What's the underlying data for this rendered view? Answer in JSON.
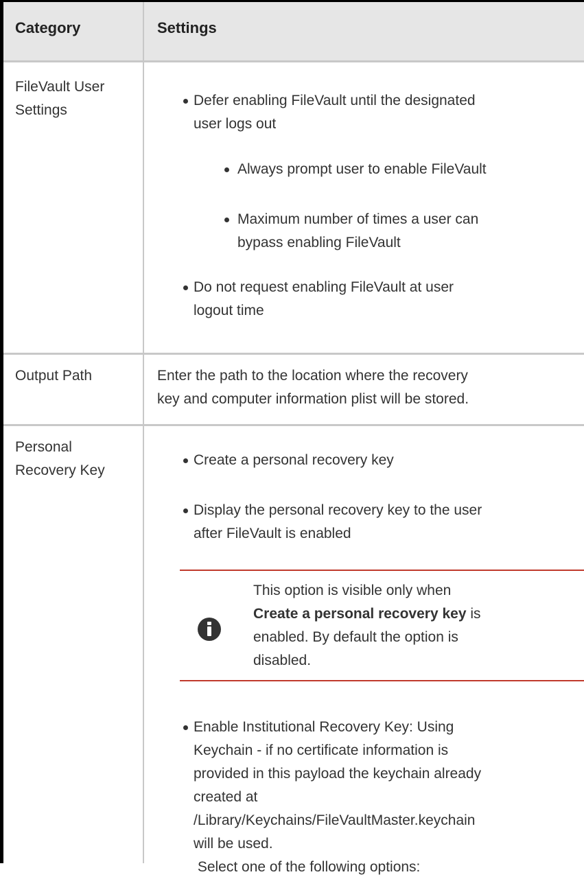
{
  "table": {
    "headers": {
      "category": "Category",
      "settings": "Settings"
    },
    "rows": [
      {
        "category": [
          "FileVault User",
          "Settings"
        ],
        "items": [
          [
            "Defer enabling FileVault until the designated",
            "user logs out"
          ],
          [
            "Always prompt user to enable FileVault"
          ],
          [
            "Maximum number of times a user can",
            "bypass enabling FileVault"
          ],
          [
            "Do not request enabling FileVault at user",
            "logout time"
          ]
        ]
      },
      {
        "category": [
          "Output Path"
        ],
        "text": [
          "Enter the path to the location where the recovery",
          "key and computer information plist will be stored."
        ]
      },
      {
        "category": [
          "Personal",
          "Recovery Key"
        ],
        "items": [
          [
            "Create a personal recovery key"
          ],
          [
            "Display the personal recovery key to the user",
            "after FileVault is enabled"
          ]
        ],
        "note": {
          "line1": "This option is visible only when",
          "bold": "Create a personal recovery key",
          "line2_rest": " is",
          "line3": "enabled. By default the option is",
          "line4": "disabled."
        },
        "items_after_note": [
          [
            "Enable Institutional Recovery Key: Using",
            "Keychain - if no certificate information is",
            "provided in this payload the keychain already",
            "created at",
            "/Library/Keychains/FileVaultMaster.keychain",
            "will be used.",
            " Select one of the following options:"
          ]
        ]
      }
    ]
  },
  "colors": {
    "header_bg": "#e6e6e6",
    "grid": "#c8c8c8",
    "note_rule": "#c0392b",
    "text": "#333333"
  },
  "icons": {
    "note": "info-icon"
  }
}
